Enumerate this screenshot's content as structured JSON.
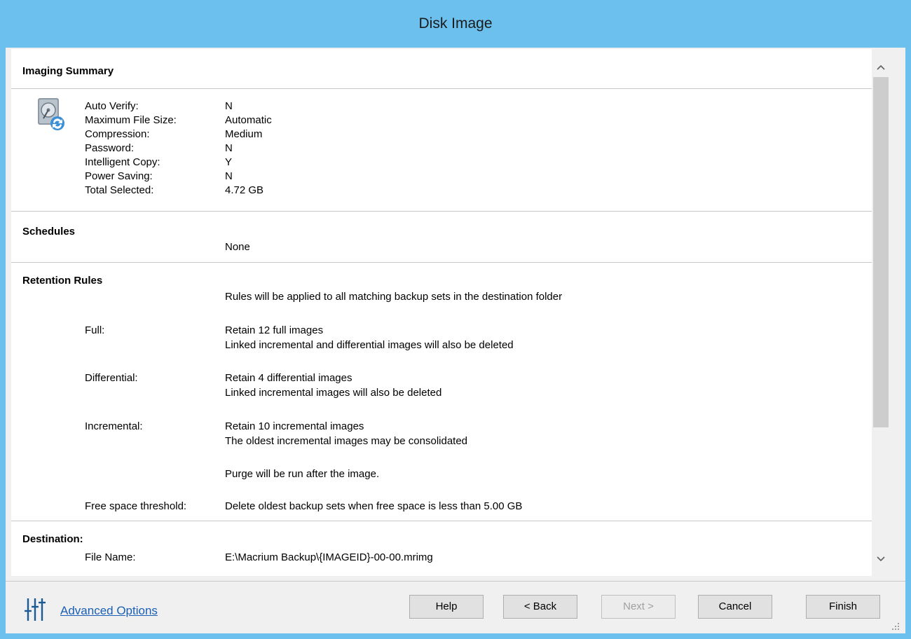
{
  "window": {
    "title": "Disk Image"
  },
  "imaging_summary": {
    "heading": "Imaging Summary",
    "rows": [
      {
        "label": "Auto Verify:",
        "value": "N"
      },
      {
        "label": "Maximum File Size:",
        "value": "Automatic"
      },
      {
        "label": "Compression:",
        "value": "Medium"
      },
      {
        "label": "Password:",
        "value": "N"
      },
      {
        "label": "Intelligent Copy:",
        "value": "Y"
      },
      {
        "label": "Power Saving:",
        "value": "N"
      },
      {
        "label": "Total Selected:",
        "value": "4.72 GB"
      }
    ],
    "icon": "disk-image-icon"
  },
  "schedules": {
    "heading": "Schedules",
    "value": "None"
  },
  "retention": {
    "heading": "Retention Rules",
    "intro": "Rules will be applied to all matching backup sets in the destination folder",
    "full": {
      "label": "Full:",
      "line1": "Retain 12 full images",
      "line2": "Linked incremental and differential images will also be deleted"
    },
    "differential": {
      "label": "Differential:",
      "line1": "Retain 4 differential images",
      "line2": "Linked incremental images will also be deleted"
    },
    "incremental": {
      "label": "Incremental:",
      "line1": "Retain 10 incremental images",
      "line2": "The oldest incremental images may be consolidated"
    },
    "purge": "Purge will be run after the image.",
    "free_space": {
      "label": "Free space threshold:",
      "value": "Delete oldest backup sets when free space is less than 5.00 GB"
    }
  },
  "destination": {
    "heading": "Destination:",
    "file_name_label": "File Name:",
    "file_name_value": "E:\\Macrium Backup\\{IMAGEID}-00-00.mrimg"
  },
  "footer": {
    "advanced_options": "Advanced Options",
    "help": "Help",
    "back": "< Back",
    "next": "Next >",
    "cancel": "Cancel",
    "finish": "Finish"
  },
  "icons": {
    "scroll_up": "chevron-up-icon",
    "scroll_down": "chevron-down-icon",
    "advanced": "sliders-icon"
  }
}
